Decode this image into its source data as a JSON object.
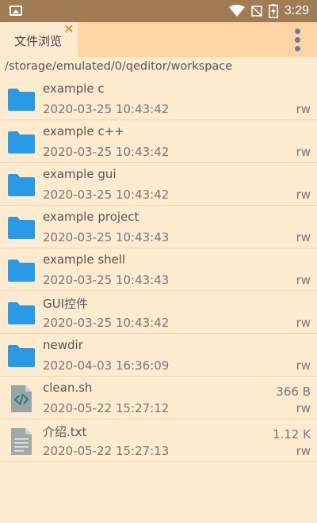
{
  "status_bar": {
    "time": "3:29",
    "icons": [
      "image-icon",
      "wifi-icon",
      "no-signal-icon",
      "battery-charging-icon"
    ]
  },
  "tab": {
    "label": "文件浏览",
    "close": "✕"
  },
  "path": "/storage/emulated/0/qeditor/workspace",
  "files": [
    {
      "name": "example c",
      "date": "2020-03-25 10:43:42",
      "size": "",
      "perm": "rw",
      "type": "folder"
    },
    {
      "name": "example c++",
      "date": "2020-03-25 10:43:42",
      "size": "",
      "perm": "rw",
      "type": "folder"
    },
    {
      "name": "example gui",
      "date": "2020-03-25 10:43:42",
      "size": "",
      "perm": "rw",
      "type": "folder"
    },
    {
      "name": "example project",
      "date": "2020-03-25 10:43:43",
      "size": "",
      "perm": "rw",
      "type": "folder"
    },
    {
      "name": "example shell",
      "date": "2020-03-25 10:43:43",
      "size": "",
      "perm": "rw",
      "type": "folder"
    },
    {
      "name": "GUI控件",
      "date": "2020-03-25 10:43:42",
      "size": "",
      "perm": "rw",
      "type": "folder"
    },
    {
      "name": "newdir",
      "date": "2020-04-03 16:36:09",
      "size": "",
      "perm": "rw",
      "type": "folder"
    },
    {
      "name": "clean.sh",
      "date": "2020-05-22 15:27:12",
      "size": "366 B",
      "perm": "rw",
      "type": "code"
    },
    {
      "name": "介绍.txt",
      "date": "2020-05-22 15:27:13",
      "size": "1.12 K",
      "perm": "rw",
      "type": "text"
    }
  ],
  "colors": {
    "status_bar": "#a07b54",
    "tab_bar": "#fdd4a4",
    "background": "#fdebd0",
    "folder": "#2a9ae6",
    "close_accent": "#e07b22",
    "menu_dots": "#6d7ba3"
  }
}
